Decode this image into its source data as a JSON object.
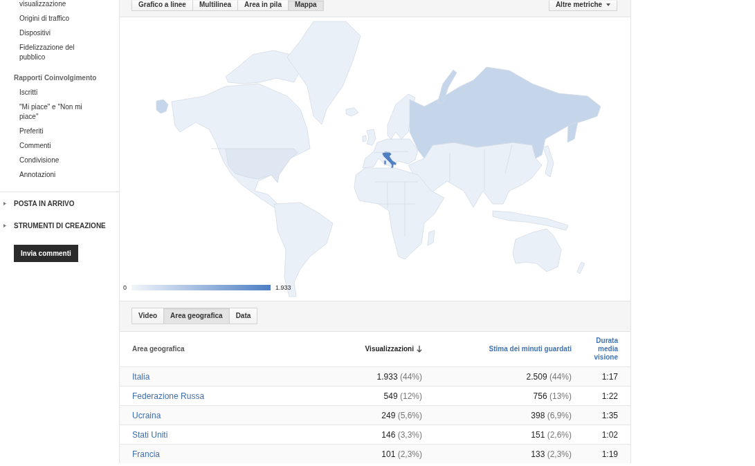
{
  "sidebar": {
    "report_items": [
      {
        "label": "visualizzazione",
        "selected": false
      },
      {
        "label": "Origini di traffico",
        "selected": false
      },
      {
        "label": "Dispositivi",
        "selected": false
      },
      {
        "label": "Fidelizzazione del pubblico",
        "selected": false
      }
    ],
    "groups": [
      {
        "title": "Rapporti Coinvolgimento",
        "items": [
          {
            "label": "Iscritti",
            "selected": false
          },
          {
            "label": "\"Mi piace\" e \"Non mi piace\"",
            "selected": false
          },
          {
            "label": "Preferiti",
            "selected": false
          },
          {
            "label": "Commenti",
            "selected": false
          },
          {
            "label": "Condivisione",
            "selected": false
          },
          {
            "label": "Annotazioni",
            "selected": false
          }
        ]
      }
    ],
    "sections": [
      {
        "label": "POSTA IN ARRIVO",
        "expanded": false
      },
      {
        "label": "STRUMENTI DI CREAZIONE",
        "expanded": false
      }
    ],
    "feedback_button": "Invia commenti"
  },
  "chart_toolbar": {
    "chart_types": [
      {
        "label": "Grafico a linee",
        "selected": false
      },
      {
        "label": "Multilinea",
        "selected": false
      },
      {
        "label": "Area in pila",
        "selected": false
      },
      {
        "label": "Mappa",
        "selected": true
      }
    ],
    "metrics_button": "Altre metriche"
  },
  "map": {
    "legend_min": "0",
    "legend_max": "1.933"
  },
  "dimension_tabs": [
    {
      "label": "Video",
      "selected": false
    },
    {
      "label": "Area geografica",
      "selected": true
    },
    {
      "label": "Data",
      "selected": false
    }
  ],
  "table": {
    "columns": [
      {
        "label": "Area geografica",
        "kind": "plain"
      },
      {
        "label": "Visualizzazioni",
        "kind": "sorted"
      },
      {
        "label": "Stima dei minuti guardati",
        "kind": "link"
      },
      {
        "label": "Durata media visione",
        "kind": "link"
      }
    ],
    "rows": [
      {
        "area": "Italia",
        "views": "1.933",
        "views_share": "(44%)",
        "minutes": "2.509",
        "minutes_share": "(44%)",
        "avg_duration": "1:17"
      },
      {
        "area": "Federazione Russa",
        "views": "549",
        "views_share": "(12%)",
        "minutes": "756",
        "minutes_share": "(13%)",
        "avg_duration": "1:22"
      },
      {
        "area": "Ucraina",
        "views": "249",
        "views_share": "(5,6%)",
        "minutes": "398",
        "minutes_share": "(6,9%)",
        "avg_duration": "1:35"
      },
      {
        "area": "Stati Uniti",
        "views": "146",
        "views_share": "(3,3%)",
        "minutes": "151",
        "minutes_share": "(2,6%)",
        "avg_duration": "1:02"
      },
      {
        "area": "Francia",
        "views": "101",
        "views_share": "(2,3%)",
        "minutes": "133",
        "minutes_share": "(2,3%)",
        "avg_duration": "1:19"
      }
    ]
  }
}
